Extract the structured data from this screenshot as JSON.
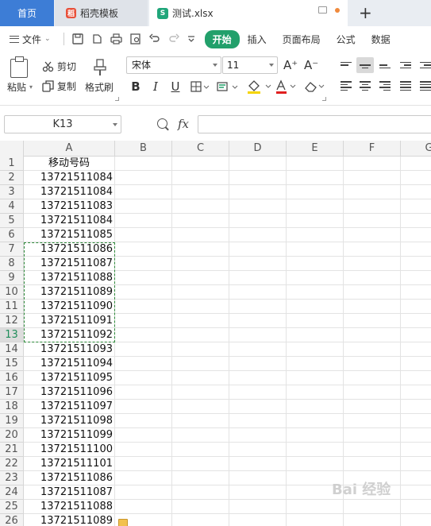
{
  "tabs": {
    "home": "首页",
    "doc": "稻壳模板",
    "doc_logo": "稻",
    "active_file": "测试.xlsx",
    "active_logo": "S",
    "unsaved_dot_color": "#f08a3c"
  },
  "menu": {
    "file_label": "文件",
    "items": [
      "开始",
      "插入",
      "页面布局",
      "公式",
      "数据"
    ],
    "active_index": 0,
    "accent": "#22a06b"
  },
  "ribbon": {
    "paste": "粘贴",
    "cut": "剪切",
    "copy": "复制",
    "format_painter": "格式刷",
    "font_name": "宋体",
    "font_size": "11",
    "bold": "B",
    "italic": "I",
    "underline": "U",
    "grow_font": "A⁺",
    "shrink_font": "A⁻",
    "font_color_swatch": "#e02020",
    "fill_color_swatch": "#f5d400"
  },
  "formula_bar": {
    "name_box": "K13",
    "fx": "fx",
    "formula": ""
  },
  "sheet": {
    "columns": [
      "A",
      "B",
      "C",
      "D",
      "E",
      "F",
      "G"
    ],
    "header_cell": "移动号码",
    "selected_row": 13,
    "marquee_rows": "7-13",
    "rows": [
      {
        "n": "1",
        "a": "移动号码"
      },
      {
        "n": "2",
        "a": "13721511084"
      },
      {
        "n": "3",
        "a": "13721511084"
      },
      {
        "n": "4",
        "a": "13721511083"
      },
      {
        "n": "5",
        "a": "13721511084"
      },
      {
        "n": "6",
        "a": "13721511085"
      },
      {
        "n": "7",
        "a": "13721511086"
      },
      {
        "n": "8",
        "a": "13721511087"
      },
      {
        "n": "9",
        "a": "13721511088"
      },
      {
        "n": "10",
        "a": "13721511089"
      },
      {
        "n": "11",
        "a": "13721511090"
      },
      {
        "n": "12",
        "a": "13721511091"
      },
      {
        "n": "13",
        "a": "13721511092"
      },
      {
        "n": "14",
        "a": "13721511093"
      },
      {
        "n": "15",
        "a": "13721511094"
      },
      {
        "n": "16",
        "a": "13721511095"
      },
      {
        "n": "17",
        "a": "13721511096"
      },
      {
        "n": "18",
        "a": "13721511097"
      },
      {
        "n": "19",
        "a": "13721511098"
      },
      {
        "n": "20",
        "a": "13721511099"
      },
      {
        "n": "21",
        "a": "13721511100"
      },
      {
        "n": "22",
        "a": "13721511101"
      },
      {
        "n": "23",
        "a": "13721511086"
      },
      {
        "n": "24",
        "a": "13721511087"
      },
      {
        "n": "25",
        "a": "13721511088"
      },
      {
        "n": "26",
        "a": "13721511089"
      }
    ]
  },
  "watermark": "Bai 经验"
}
